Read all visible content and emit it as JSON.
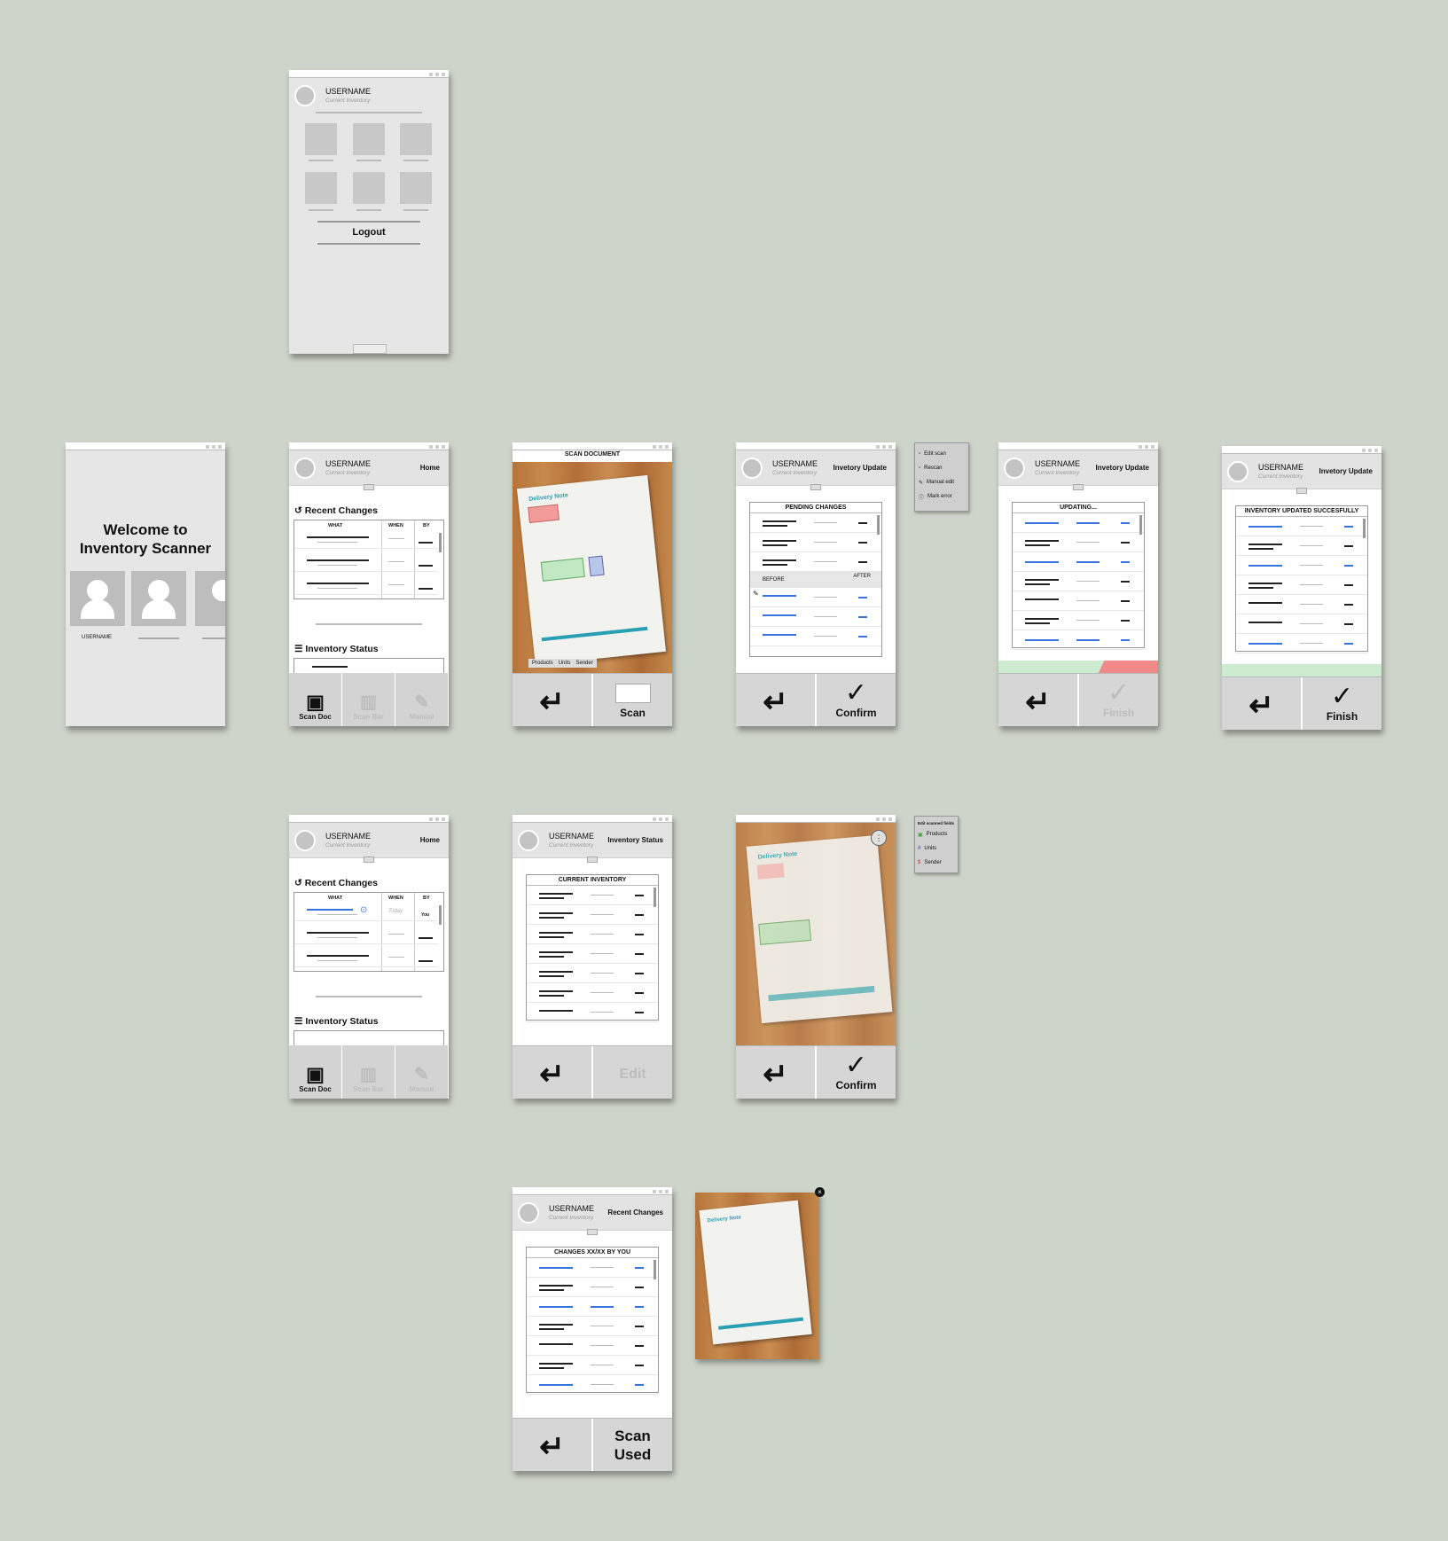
{
  "user": {
    "name": "USERNAME",
    "sub": "Current Inventory"
  },
  "menu": {
    "logout": "Logout"
  },
  "welcome": {
    "title": "Welcome to Inventory Scanner",
    "user_label": "USERNAME"
  },
  "home": {
    "title": "Home",
    "recent": "Recent Changes",
    "status": "Inventory Status",
    "cols": [
      "WHAT",
      "WHEN",
      "BY"
    ],
    "today": "Today",
    "you": "You",
    "scan_doc": "Scan Doc",
    "scan_bar": "Scan Bar",
    "manual": "Manual"
  },
  "scan": {
    "title": "SCAN DOCUMENT",
    "note": "Delivery Note",
    "chips": [
      "Products",
      "Units",
      "Sender"
    ],
    "scan_btn": "Scan"
  },
  "update": {
    "title": "Invetory Update",
    "pending": "PENDING CHANGES",
    "before": "BEFORE",
    "after": "AFTER",
    "confirm": "Confirm",
    "updating": "UPDATING...",
    "finish": "Finish",
    "done": "INVENTORY UPDATED SUCCESFULLY"
  },
  "edit_menu": [
    "Edit scan",
    "Rescan",
    "Manual edit",
    "Mark error"
  ],
  "fields_menu": {
    "title": "Edit scanned fields",
    "items": [
      "Products",
      "Units",
      "Sender"
    ]
  },
  "status": {
    "title": "Inventory Status",
    "current": "CURRENT INVENTORY",
    "edit": "Edit"
  },
  "recent": {
    "title": "Recent Changes",
    "box": "CHANGES XX/XX BY YOU",
    "scan_used": "Scan Used"
  },
  "colors": {
    "bg": "#cdd4c9",
    "accent": "#3a73e0",
    "success": "#cdeccf",
    "error": "#f08a8a"
  }
}
